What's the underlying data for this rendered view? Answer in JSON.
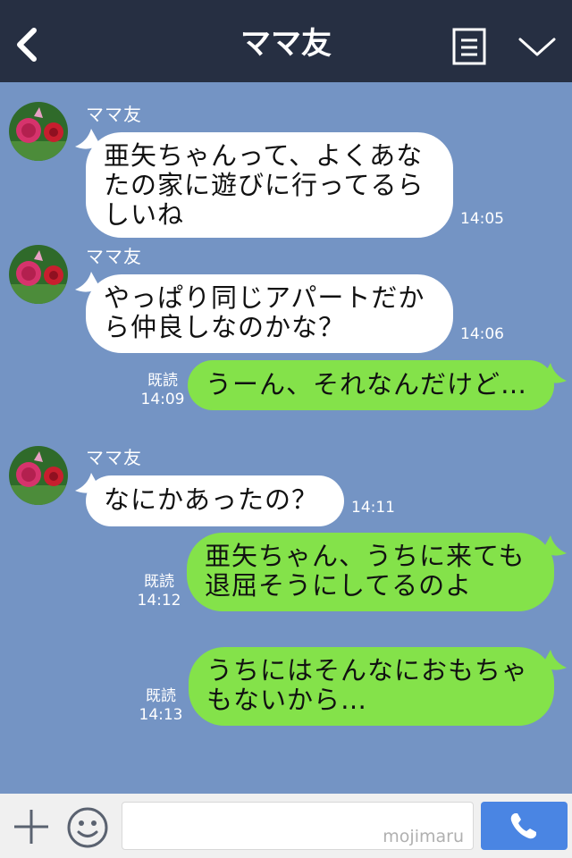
{
  "header": {
    "title": "ママ友",
    "back_icon": "chevron-left-icon",
    "notes_icon": "notes-icon",
    "expand_icon": "chevron-down-icon"
  },
  "colors": {
    "header_bg": "#262f42",
    "chat_bg": "#7494c4",
    "incoming_bubble": "#ffffff",
    "outgoing_bubble": "#84e24a",
    "call_button": "#4a85e3"
  },
  "messages": [
    {
      "direction": "incoming",
      "sender": "ママ友",
      "lines": [
        "亜矢ちゃんって、よくあな",
        "たの家に遊びに行ってるら",
        "しいね"
      ],
      "time": "14:05"
    },
    {
      "direction": "incoming",
      "sender": "ママ友",
      "lines": [
        "やっぱり同じアパートだか",
        "ら仲良しなのかな？"
      ],
      "time": "14:06"
    },
    {
      "direction": "outgoing",
      "read": "既読",
      "lines": [
        "うーん、それなんだけど…"
      ],
      "time": "14:09"
    },
    {
      "direction": "incoming",
      "sender": "ママ友",
      "lines": [
        "なにかあったの？"
      ],
      "time": "14:11"
    },
    {
      "direction": "outgoing",
      "read": "既読",
      "lines": [
        "亜矢ちゃん、うちに来ても",
        "退屈そうにしてるのよ"
      ],
      "time": "14:12"
    },
    {
      "direction": "outgoing",
      "read": "既読",
      "lines": [
        "うちにはそんなにおもちゃ",
        "もないから…"
      ],
      "time": "14:13"
    }
  ],
  "footer": {
    "plus_icon": "plus-icon",
    "emoji_icon": "emoji-icon",
    "input_value": "",
    "watermark": "mojimaru",
    "call_icon": "phone-icon"
  }
}
